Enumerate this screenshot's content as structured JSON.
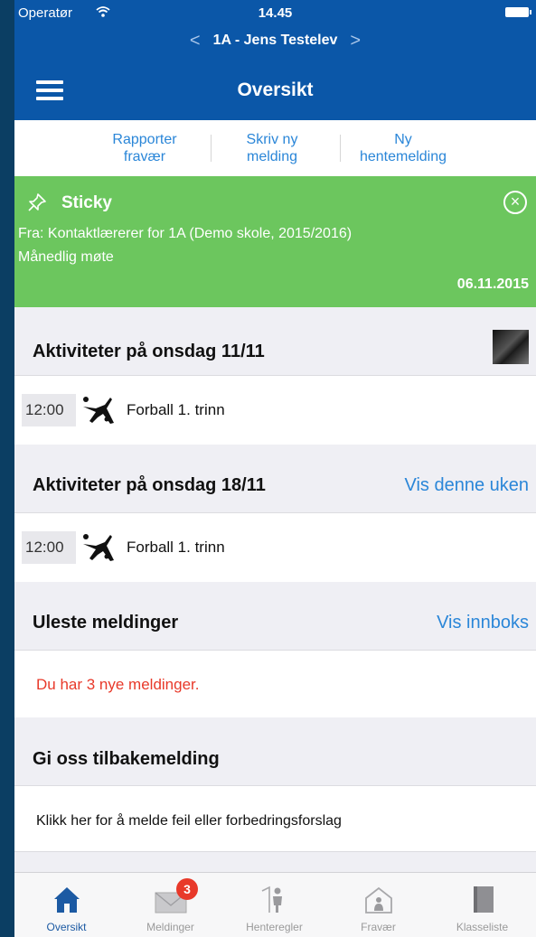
{
  "status_bar": {
    "operator": "Operatør",
    "time": "14.45"
  },
  "student_switcher": {
    "prev": "<",
    "name": "1A - Jens Testelev",
    "next": ">"
  },
  "header": {
    "title": "Oversikt"
  },
  "actions": [
    {
      "line1": "Rapporter",
      "line2": "fravær"
    },
    {
      "line1": "Skriv ny",
      "line2": "melding"
    },
    {
      "line1": "Ny",
      "line2": "hentemelding"
    }
  ],
  "sticky": {
    "title": "Sticky",
    "from": "Fra: Kontaktlærerer for 1A (Demo skole, 2015/2016)",
    "subject": "Månedlig møte",
    "date": "06.11.2015",
    "close": "×"
  },
  "activities1": {
    "heading": "Aktiviteter på onsdag 11/11",
    "time": "12:00",
    "name": "Forball 1. trinn"
  },
  "activities2": {
    "heading": "Aktiviteter på onsdag 18/11",
    "link": "Vis denne uken",
    "time": "12:00",
    "name": "Forball 1. trinn"
  },
  "unread": {
    "heading": "Uleste meldinger",
    "link": "Vis innboks",
    "text": "Du har 3 nye meldinger."
  },
  "feedback": {
    "heading": "Gi oss tilbakemelding",
    "text": "Klikk her for å melde feil eller forbedringsforslag"
  },
  "tabs": [
    {
      "label": "Oversikt",
      "icon": "home-icon",
      "active": true
    },
    {
      "label": "Meldinger",
      "icon": "envelope-icon",
      "badge": "3"
    },
    {
      "label": "Henteregler",
      "icon": "pickup-person-icon"
    },
    {
      "label": "Fravær",
      "icon": "house-person-icon"
    },
    {
      "label": "Klasseliste",
      "icon": "book-icon"
    }
  ],
  "colors": {
    "primary": "#0b57a8",
    "link": "#2a86d8",
    "sticky": "#6cc65e",
    "alert": "#e8392a",
    "badge": "#e8392a"
  }
}
